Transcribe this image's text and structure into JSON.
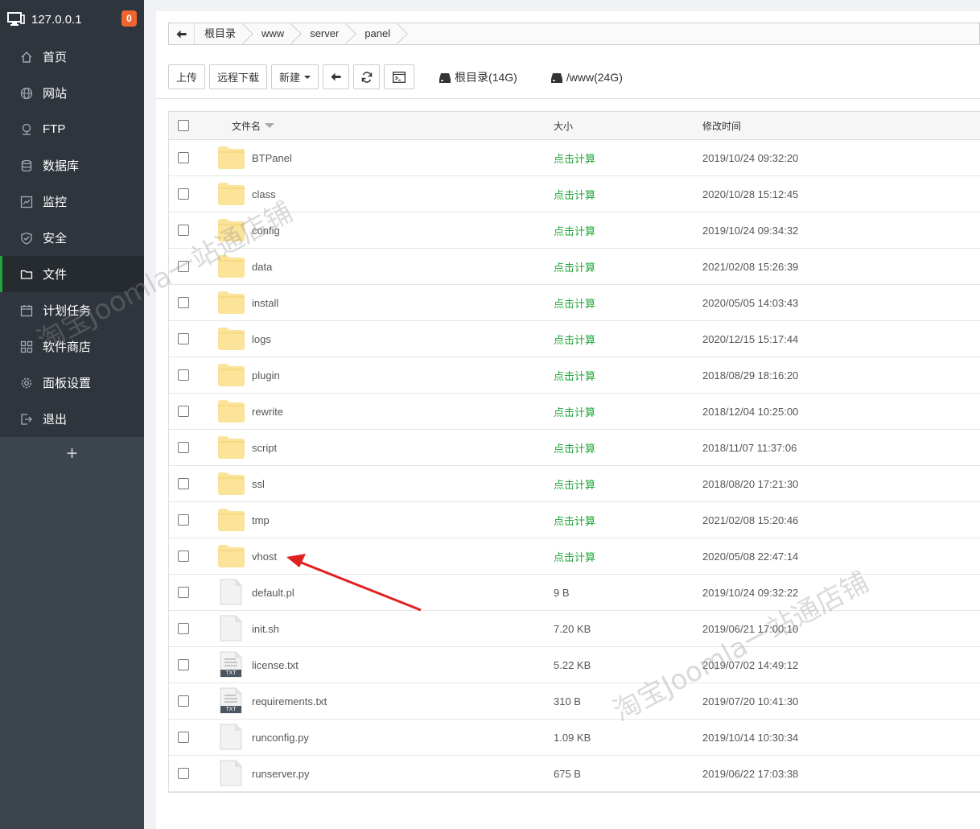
{
  "sidebar": {
    "host": "127.0.0.1",
    "badge": "0",
    "items": [
      {
        "label": "首页",
        "icon": "home-icon"
      },
      {
        "label": "网站",
        "icon": "globe-icon"
      },
      {
        "label": "FTP",
        "icon": "ftp-icon"
      },
      {
        "label": "数据库",
        "icon": "database-icon"
      },
      {
        "label": "监控",
        "icon": "monitor-icon"
      },
      {
        "label": "安全",
        "icon": "shield-icon"
      },
      {
        "label": "文件",
        "icon": "folder-icon",
        "active": true
      },
      {
        "label": "计划任务",
        "icon": "clock-icon"
      },
      {
        "label": "软件商店",
        "icon": "apps-icon"
      },
      {
        "label": "面板设置",
        "icon": "gear-icon"
      },
      {
        "label": "退出",
        "icon": "logout-icon"
      }
    ],
    "plus": "+"
  },
  "breadcrumb": [
    "根目录",
    "www",
    "server",
    "panel"
  ],
  "toolbar": {
    "upload": "上传",
    "remote_download": "远程下载",
    "new": "新建",
    "disks": [
      "根目录(14G)",
      "/www(24G)"
    ]
  },
  "table": {
    "columns": {
      "name": "文件名",
      "size": "大小",
      "time": "修改时间"
    },
    "rows": [
      {
        "name": "BTPanel",
        "type": "folder",
        "size": "点击计算",
        "time": "2019/10/24 09:32:20"
      },
      {
        "name": "class",
        "type": "folder",
        "size": "点击计算",
        "time": "2020/10/28 15:12:45"
      },
      {
        "name": "config",
        "type": "folder",
        "size": "点击计算",
        "time": "2019/10/24 09:34:32"
      },
      {
        "name": "data",
        "type": "folder",
        "size": "点击计算",
        "time": "2021/02/08 15:26:39"
      },
      {
        "name": "install",
        "type": "folder",
        "size": "点击计算",
        "time": "2020/05/05 14:03:43"
      },
      {
        "name": "logs",
        "type": "folder",
        "size": "点击计算",
        "time": "2020/12/15 15:17:44"
      },
      {
        "name": "plugin",
        "type": "folder",
        "size": "点击计算",
        "time": "2018/08/29 18:16:20"
      },
      {
        "name": "rewrite",
        "type": "folder",
        "size": "点击计算",
        "time": "2018/12/04 10:25:00"
      },
      {
        "name": "script",
        "type": "folder",
        "size": "点击计算",
        "time": "2018/11/07 11:37:06"
      },
      {
        "name": "ssl",
        "type": "folder",
        "size": "点击计算",
        "time": "2018/08/20 17:21:30"
      },
      {
        "name": "tmp",
        "type": "folder",
        "size": "点击计算",
        "time": "2021/02/08 15:20:46"
      },
      {
        "name": "vhost",
        "type": "folder",
        "size": "点击计算",
        "time": "2020/05/08 22:47:14"
      },
      {
        "name": "default.pl",
        "type": "file",
        "size": "9 B",
        "time": "2019/10/24 09:32:22"
      },
      {
        "name": "init.sh",
        "type": "file",
        "size": "7.20 KB",
        "time": "2019/06/21 17:00:10"
      },
      {
        "name": "license.txt",
        "type": "txt",
        "size": "5.22 KB",
        "time": "2019/07/02 14:49:12"
      },
      {
        "name": "requirements.txt",
        "type": "txt",
        "size": "310 B",
        "time": "2019/07/20 10:41:30"
      },
      {
        "name": "runconfig.py",
        "type": "file",
        "size": "1.09 KB",
        "time": "2019/10/14 10:30:34"
      },
      {
        "name": "runserver.py",
        "type": "file",
        "size": "675 B",
        "time": "2019/06/22 17:03:38"
      }
    ]
  },
  "txt_badge": "TXT",
  "watermark": "淘宝Joomla一站通店铺",
  "colors": {
    "accent": "#20a53a",
    "sidebar": "#3c444d",
    "badge": "#f0652f",
    "arrow": "#e02020",
    "folder": "#fbe39a"
  }
}
